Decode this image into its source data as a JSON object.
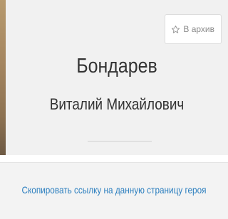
{
  "archive": {
    "label": "В архив",
    "icon": "star-outline-icon"
  },
  "hero": {
    "surname": "Бондарев",
    "given_names": "Виталий Михайлович"
  },
  "links": {
    "copy_page_link": "Скопировать ссылку на данную страницу героя"
  },
  "colors": {
    "link": "#2c7fbf",
    "text": "#333333",
    "muted": "#8a8a8a",
    "card_background": "#f1f1f1"
  }
}
